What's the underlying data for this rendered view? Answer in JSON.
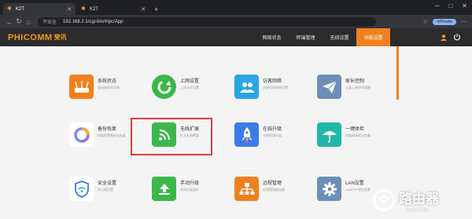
{
  "browser": {
    "tabs": [
      {
        "label": "K2T",
        "active": true
      },
      {
        "label": "K2T",
        "active": false
      }
    ],
    "new_tab": "+",
    "window_controls": [
      "─",
      "□",
      "✕"
    ],
    "security_label": "不安全",
    "url": "192.168.2.1/cgi-bin/#/pc/App",
    "profile_label": "InPrivate"
  },
  "app": {
    "logo": "PHICOMM",
    "logo_cn": "斐讯",
    "menu": [
      {
        "label": "网络状态",
        "active": false
      },
      {
        "label": "终端管理",
        "active": false
      },
      {
        "label": "无线设置",
        "active": false
      },
      {
        "label": "功能设置",
        "active": true
      }
    ]
  },
  "cards": [
    {
      "title": "系统状态",
      "desc": "路由器状态详情",
      "color": "#f0801e",
      "icon": "router-icon"
    },
    {
      "title": "上网设置",
      "desc": "上网方式设置",
      "color": "#3cb84a",
      "icon": "refresh-icon"
    },
    {
      "title": "访客网络",
      "desc": "访客无线网络设置",
      "color": "#2aa5e8",
      "icon": "guests-icon"
    },
    {
      "title": "家长控制",
      "desc": "儿童上网时间管理",
      "color": "#6c8fb5",
      "icon": "paper-plane-icon"
    },
    {
      "title": "备份恢复",
      "desc": "网络配置备份与恢复",
      "color": "#ffffff",
      "icon": "ring-icon"
    },
    {
      "title": "无线扩展",
      "desc": "扩大无线覆盖",
      "color": "#3cb84a",
      "icon": "wifi-extend-icon"
    },
    {
      "title": "在线升级",
      "desc": "在线检测升级",
      "color": "#3b7be8",
      "icon": "rocket-icon"
    },
    {
      "title": "一键体检",
      "desc": "网络健康状况检查",
      "color": "#21b7a8",
      "icon": "umbrella-icon"
    },
    {
      "title": "安全设置",
      "desc": "防火墙设置",
      "color": "#ffffff",
      "icon": "shield-wifi-icon"
    },
    {
      "title": "手动升级",
      "desc": "本地升级固件",
      "color": "#3cb84a",
      "icon": "upload-icon"
    },
    {
      "title": "远程管理",
      "desc": "远程管理路由器",
      "color": "#f0801e",
      "icon": "network-icon"
    },
    {
      "title": "LAN设置",
      "desc": "LAN口IP地址设置",
      "color": "#6c8fb5",
      "icon": "gear-icon"
    }
  ],
  "watermark": {
    "text": "路由器",
    "sub": "luyouqi.com"
  }
}
